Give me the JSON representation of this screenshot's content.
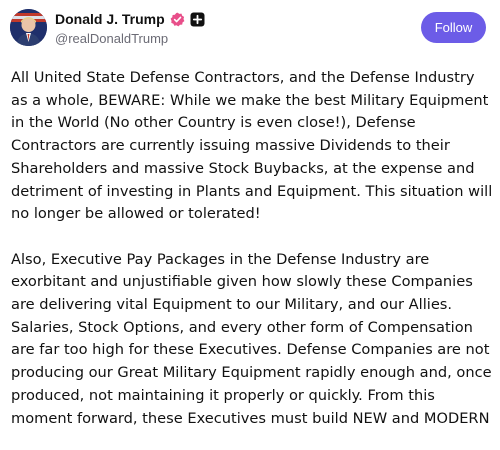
{
  "author": {
    "display_name": "Donald J. Trump",
    "handle": "@realDonaldTrump",
    "verified_icon": "verified-badge-icon",
    "extra_icon": "plus-square-icon",
    "avatar_icon": "avatar-image"
  },
  "follow_button": {
    "label": "Follow",
    "color": "#6c5ce7"
  },
  "post": {
    "paragraphs": [
      "All United State Defense Contractors, and the Defense Industry as a whole, BEWARE: While we make the best Military Equipment in the World (No other Country is even close!), Defense Contractors are currently issuing massive Dividends to their Shareholders and massive Stock Buybacks, at the expense and detriment of investing in Plants and Equipment. This situation will no longer be allowed or tolerated!",
      "Also, Executive Pay Packages in the Defense Industry are exorbitant and unjustifiable given how slowly these Companies are delivering vital Equipment to our Military, and our Allies. Salaries, Stock Options, and every other form of Compensation are far too high for these Executives. Defense Companies are not producing our Great Military Equipment rapidly enough and, once produced, not maintaining it properly or quickly. From this moment forward, these Executives must build NEW and MODERN"
    ]
  },
  "colors": {
    "accent": "#6c5ce7",
    "verified_badge": "#e84f8a",
    "handle_text": "#6b6b75"
  }
}
